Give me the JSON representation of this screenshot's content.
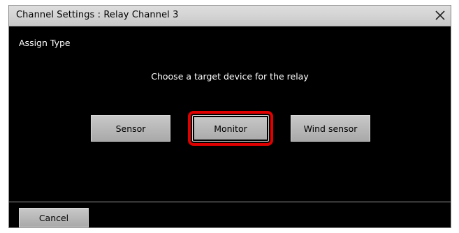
{
  "dialog": {
    "title": "Channel Settings : Relay Channel 3",
    "close_icon": "close-icon"
  },
  "content": {
    "section_label": "Assign Type",
    "prompt": "Choose a target device for the relay",
    "choices": [
      {
        "label": "Sensor",
        "selected": false
      },
      {
        "label": "Monitor",
        "selected": true
      },
      {
        "label": "Wind sensor",
        "selected": false
      }
    ]
  },
  "footer": {
    "cancel_label": "Cancel"
  },
  "colors": {
    "highlight": "#e00000",
    "background": "#000000",
    "button": "#b8b8b8"
  }
}
